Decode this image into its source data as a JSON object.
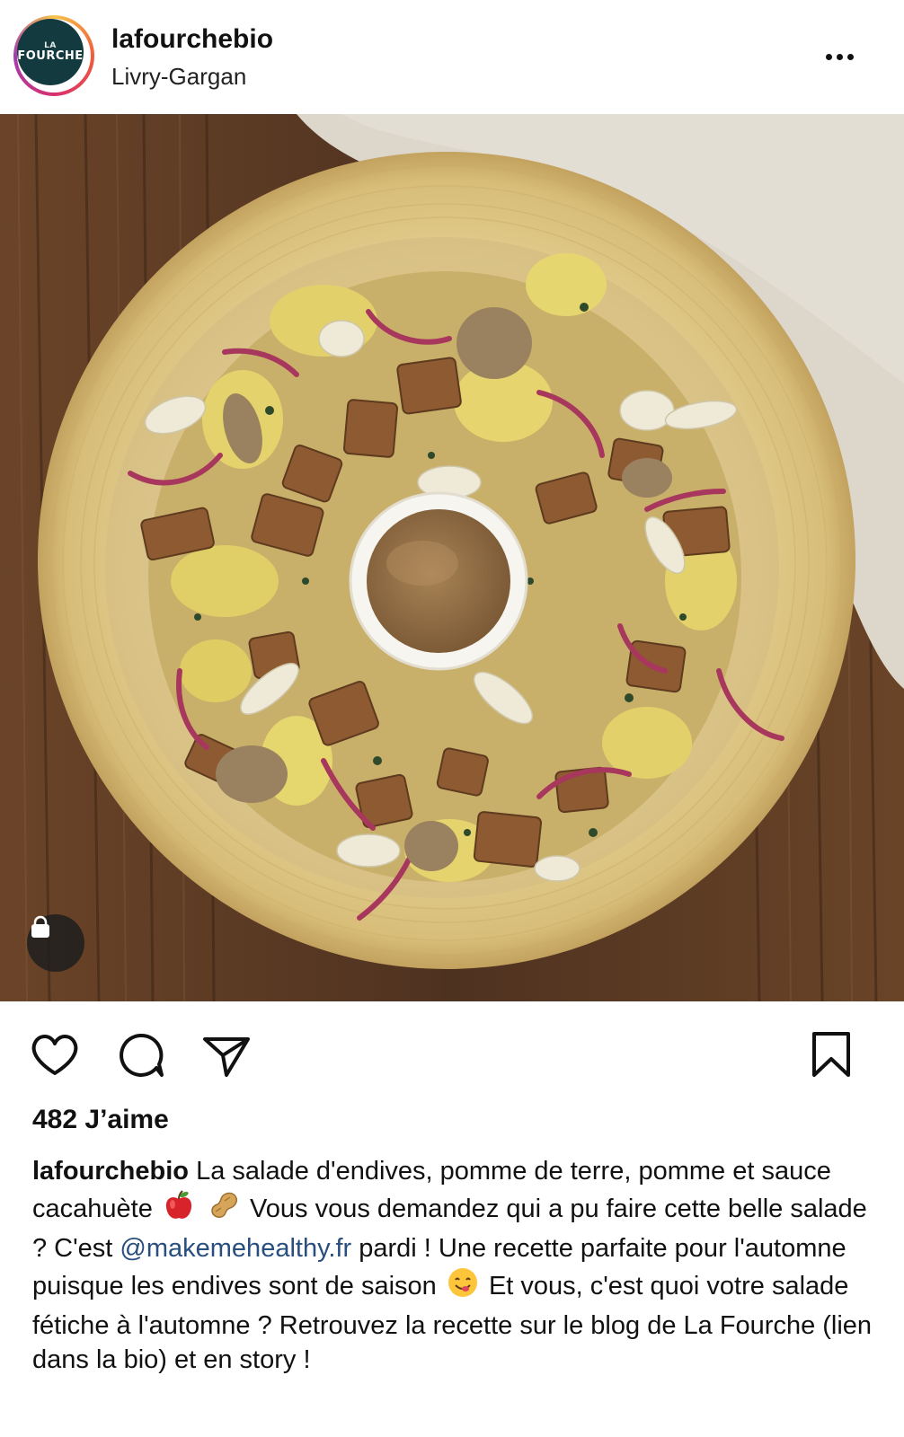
{
  "post": {
    "username": "lafourchebio",
    "location": "Livry-Gargan",
    "avatar_text_top": "LA",
    "avatar_text_bottom": "FOURCHE",
    "image_alt": "Salade d'endives, pomme de terre, tofu et sauce cacahuète dans un bol en bambou",
    "likes_label": "482 J’aime",
    "caption_user": "lafourchebio",
    "caption_part1": "La salade d'endives, pomme de terre, pomme et sauce cacahuète",
    "caption_part2": "Vous vous demandez qui a pu faire cette belle salade ? C'est",
    "caption_mention": "@makemehealthy.fr",
    "caption_part3": "pardi ! Une recette parfaite pour l'automne puisque les endives sont de saison",
    "caption_part4": "Et vous, c'est quoi votre salade fétiche à l'automne ? Retrouvez la recette sur le blog de La Fourche (lien dans la bio) et en story !"
  },
  "icons": {
    "more": "more-options-icon",
    "shopping": "shopping-bag-icon",
    "like": "heart-icon",
    "comment": "comment-icon",
    "share": "send-icon",
    "save": "bookmark-icon",
    "emoji_apple": "red-apple-emoji",
    "emoji_peanut": "peanut-emoji",
    "emoji_yum": "yum-face-emoji"
  }
}
